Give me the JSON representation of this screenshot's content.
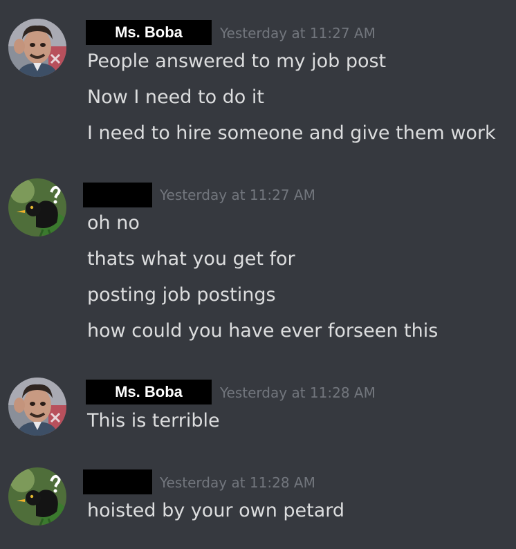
{
  "colors": {
    "background": "#36393f",
    "message_text": "#dcddde",
    "timestamp": "#72767d",
    "name_redaction_box": "#000000"
  },
  "messages": [
    {
      "author": "Ms. Boba",
      "avatar_icon": "man-portrait-avatar-icon",
      "timestamp": "Yesterday at 11:27 AM",
      "lines": [
        "People answered to my job post",
        "Now I need to do it",
        "I need to hire someone and give them work"
      ]
    },
    {
      "author": "",
      "avatar_icon": "blackbird-avatar-icon",
      "timestamp": "Yesterday at 11:27 AM",
      "lines": [
        "oh no",
        "thats what you get for",
        "posting job postings",
        "how could you have ever forseen this"
      ]
    },
    {
      "author": "Ms. Boba",
      "avatar_icon": "man-portrait-avatar-icon",
      "timestamp": "Yesterday at 11:28 AM",
      "lines": [
        "This is terrible"
      ]
    },
    {
      "author": "",
      "avatar_icon": "blackbird-avatar-icon",
      "timestamp": "Yesterday at 11:28 AM",
      "lines": [
        "hoisted by your own petard"
      ]
    }
  ]
}
